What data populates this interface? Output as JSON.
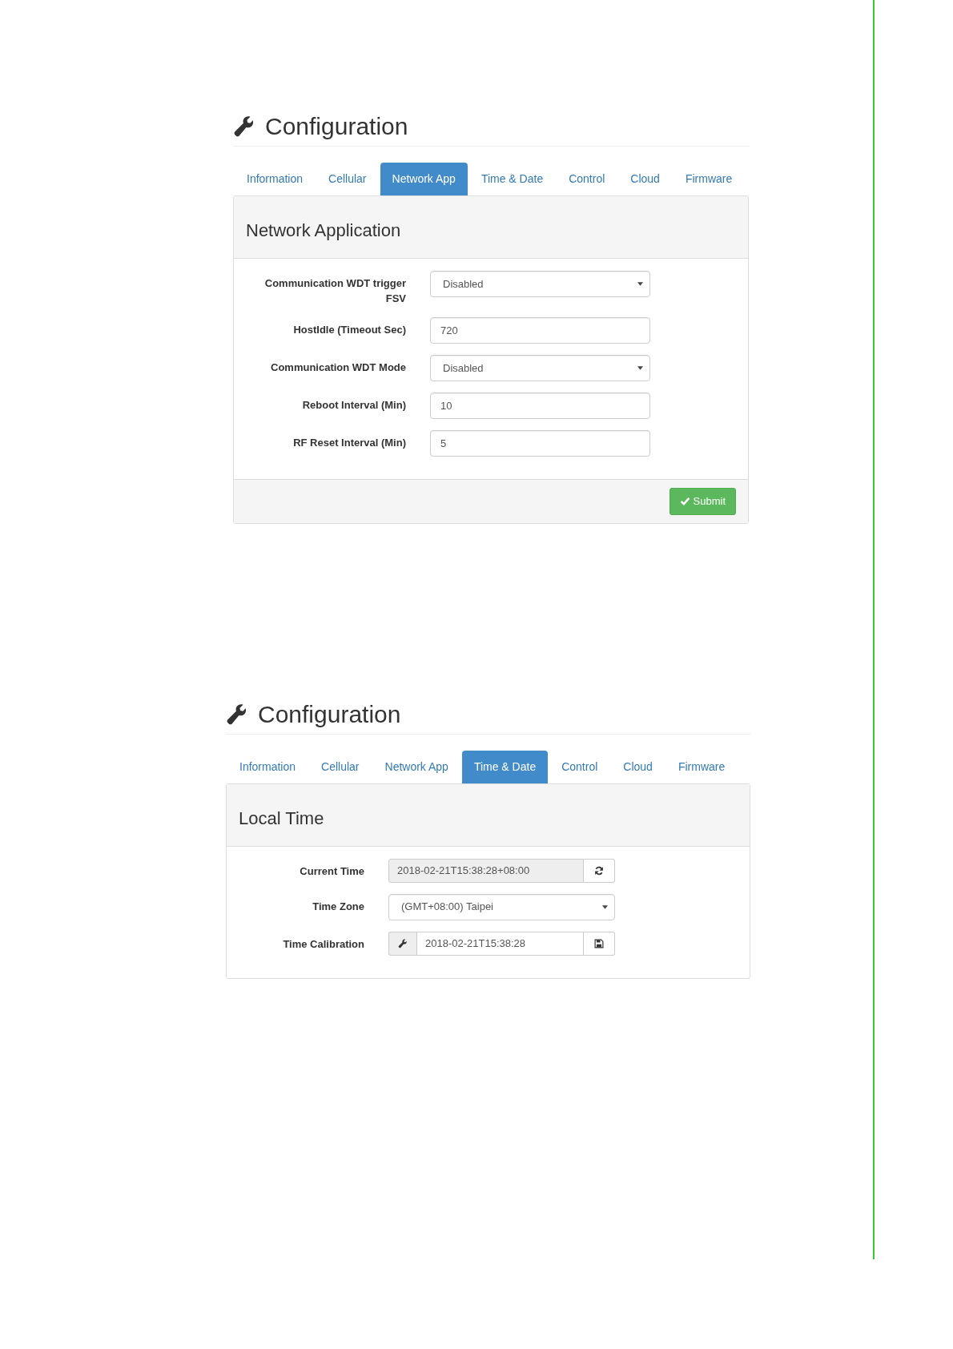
{
  "screens": [
    {
      "title": "Configuration",
      "tabs": [
        {
          "label": "Information",
          "selected": false
        },
        {
          "label": "Cellular",
          "selected": false
        },
        {
          "label": "Network App",
          "selected": true
        },
        {
          "label": "Time & Date",
          "selected": false
        },
        {
          "label": "Control",
          "selected": false
        },
        {
          "label": "Cloud",
          "selected": false
        },
        {
          "label": "Firmware",
          "selected": false
        }
      ],
      "panel": {
        "title": "Network Application",
        "fields": [
          {
            "kind": "select",
            "label": "Communication WDT trigger FSV",
            "value": "Disabled"
          },
          {
            "kind": "text",
            "label": "HostIdle (Timeout Sec)",
            "value": "720"
          },
          {
            "kind": "select",
            "label": "Communication WDT Mode",
            "value": "Disabled"
          },
          {
            "kind": "text",
            "label": "Reboot Interval (Min)",
            "value": "10"
          },
          {
            "kind": "text",
            "label": "RF Reset Interval (Min)",
            "value": "5"
          }
        ],
        "submit": "Submit"
      }
    },
    {
      "title": "Configuration",
      "tabs": [
        {
          "label": "Information",
          "selected": false
        },
        {
          "label": "Cellular",
          "selected": false
        },
        {
          "label": "Network App",
          "selected": false
        },
        {
          "label": "Time & Date",
          "selected": true
        },
        {
          "label": "Control",
          "selected": false
        },
        {
          "label": "Cloud",
          "selected": false
        },
        {
          "label": "Firmware",
          "selected": false
        }
      ],
      "panel": {
        "title": "Local Time",
        "fields": [
          {
            "kind": "refresh",
            "label": "Current Time",
            "value": "2018-02-21T15:38:28+08:00"
          },
          {
            "kind": "select",
            "label": "Time Zone",
            "value": "(GMT+08:00) Taipei"
          },
          {
            "kind": "calibrate",
            "label": "Time Calibration",
            "value": "2018-02-21T15:38:28"
          }
        ]
      }
    }
  ]
}
